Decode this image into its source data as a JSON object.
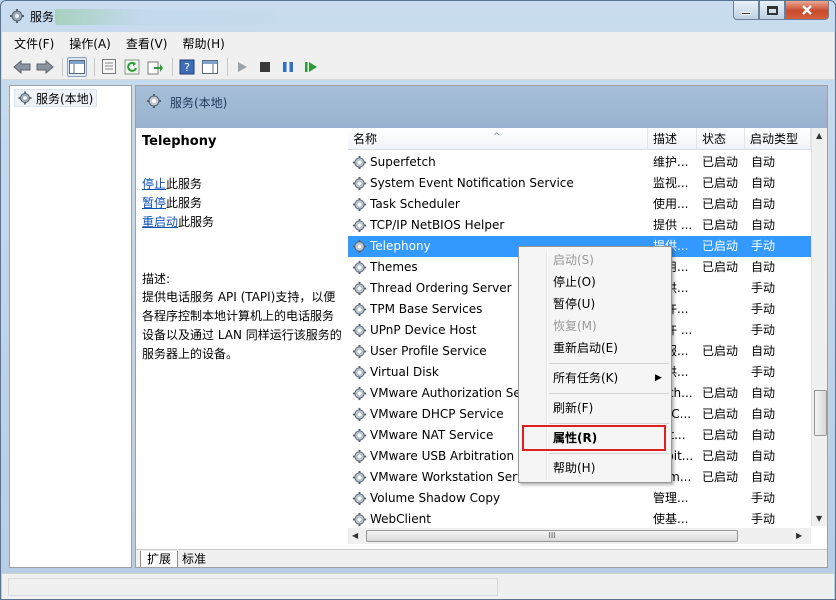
{
  "window": {
    "title": "服务"
  },
  "menubar": [
    {
      "label": "文件(F)"
    },
    {
      "label": "操作(A)"
    },
    {
      "label": "查看(V)"
    },
    {
      "label": "帮助(H)"
    }
  ],
  "tree": {
    "root_label": "服务(本地)"
  },
  "pane_header": {
    "title": "服务(本地)"
  },
  "detail": {
    "service_name": "Telephony",
    "actions": [
      {
        "link": "停止",
        "suffix": "此服务"
      },
      {
        "link": "暂停",
        "suffix": "此服务"
      },
      {
        "link": "重启动",
        "suffix": "此服务"
      }
    ],
    "desc_label": "描述:",
    "desc_lines": [
      "提供电话服务 API (TAPI)支持，以便",
      "各程序控制本地计算机上的电话服务",
      "设备以及通过 LAN 同样运行该服务的",
      "服务器上的设备。"
    ]
  },
  "columns": {
    "name": "名称",
    "desc": "描述",
    "status": "状态",
    "startup": "启动类型"
  },
  "services": [
    {
      "name": "Superfetch",
      "desc": "维护...",
      "status": "已启动",
      "startup": "自动"
    },
    {
      "name": "System Event Notification Service",
      "desc": "监视...",
      "status": "已启动",
      "startup": "自动"
    },
    {
      "name": "Task Scheduler",
      "desc": "使用...",
      "status": "已启动",
      "startup": "自动"
    },
    {
      "name": "TCP/IP NetBIOS Helper",
      "desc": "提供 ...",
      "status": "已启动",
      "startup": "自动"
    },
    {
      "name": "Telephony",
      "desc": "提供...",
      "status": "已启动",
      "startup": "手动",
      "selected": true
    },
    {
      "name": "Themes",
      "desc": "为用...",
      "status": "已启动",
      "startup": "自动"
    },
    {
      "name": "Thread Ordering Server",
      "desc": "提供...",
      "status": "",
      "startup": "手动"
    },
    {
      "name": "TPM Base Services",
      "desc": "允许...",
      "status": "",
      "startup": "手动"
    },
    {
      "name": "UPnP Device Host",
      "desc": "允许 ...",
      "status": "",
      "startup": "手动"
    },
    {
      "name": "User Profile Service",
      "desc": "此服...",
      "status": "已启动",
      "startup": "自动"
    },
    {
      "name": "Virtual Disk",
      "desc": "提供...",
      "status": "",
      "startup": "手动"
    },
    {
      "name": "VMware Authorization Service",
      "desc": "Auth...",
      "status": "已启动",
      "startup": "自动"
    },
    {
      "name": "VMware DHCP Service",
      "desc": "DHC...",
      "status": "已启动",
      "startup": "自动"
    },
    {
      "name": "VMware NAT Service",
      "desc": "Net...",
      "status": "已启动",
      "startup": "自动"
    },
    {
      "name": "VMware USB Arbitration Service",
      "desc": "Arbit...",
      "status": "已启动",
      "startup": "自动"
    },
    {
      "name": "VMware Workstation Server",
      "desc": "Rem...",
      "status": "已启动",
      "startup": "自动"
    },
    {
      "name": "Volume Shadow Copy",
      "desc": "管理...",
      "status": "",
      "startup": "手动"
    },
    {
      "name": "WebClient",
      "desc": "使基...",
      "status": "",
      "startup": "手动"
    }
  ],
  "context_menu": [
    {
      "label": "启动(S)",
      "disabled": true
    },
    {
      "label": "停止(O)"
    },
    {
      "label": "暂停(U)"
    },
    {
      "label": "恢复(M)",
      "disabled": true
    },
    {
      "label": "重新启动(E)"
    },
    {
      "label": "所有任务(K)",
      "submenu": true
    },
    {
      "label": "刷新(F)"
    },
    {
      "label": "属性(R)",
      "bold": true,
      "highlighted": true
    },
    {
      "label": "帮助(H)"
    }
  ],
  "tabs": [
    {
      "label": "扩展",
      "active": true
    },
    {
      "label": "标准"
    }
  ],
  "hscroll_glyph": "III",
  "colors": {
    "selection": "#3399ff",
    "header_band": "#98b2cf",
    "highlight_box": "#e02020"
  }
}
